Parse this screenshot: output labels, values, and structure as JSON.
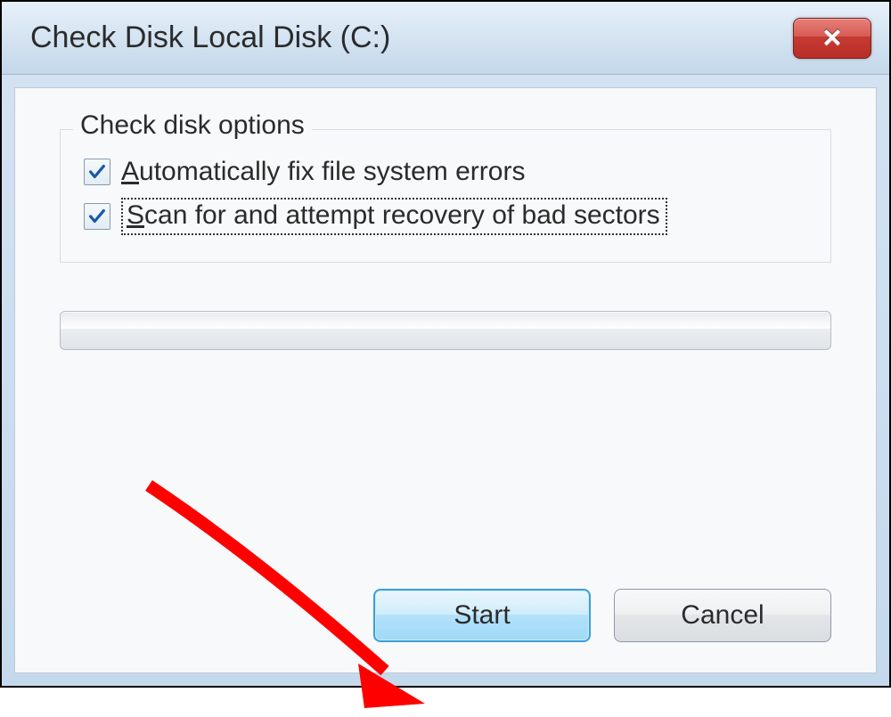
{
  "window": {
    "title": "Check Disk Local Disk (C:)"
  },
  "options": {
    "legend": "Check disk options",
    "items": [
      {
        "prefix": "A",
        "rest": "utomatically fix file system errors",
        "checked": true
      },
      {
        "prefix": "S",
        "rest": "can for and attempt recovery of bad sectors",
        "checked": true
      }
    ]
  },
  "buttons": {
    "start": "Start",
    "cancel": "Cancel"
  }
}
